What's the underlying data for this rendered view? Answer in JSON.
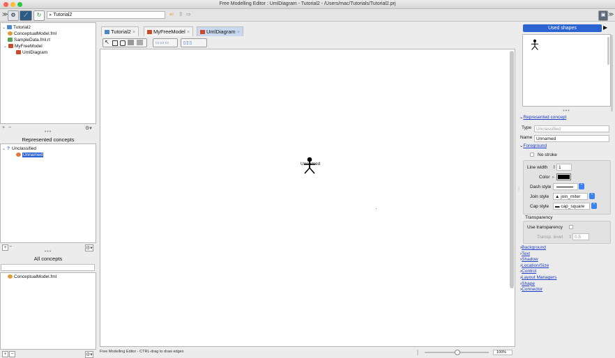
{
  "window": {
    "title": "Free Modelling Editor : UmlDiagram - Tutorial2 - /Users/mac/Tutorials/Tutorial2.prj"
  },
  "toolbar": {
    "path": "Tutorial2"
  },
  "project_tree": {
    "root": "Tutorial2",
    "items": [
      {
        "label": "ConceptualModel.fml"
      },
      {
        "label": "SampleData.fml.rt"
      },
      {
        "label": "MyFreeModel"
      },
      {
        "label": "UmlDiagram"
      }
    ]
  },
  "represented_concepts": {
    "title": "Represented concepts",
    "group": "Unclassified",
    "item": "Unnamed"
  },
  "all_concepts": {
    "title": "All concepts",
    "search_value": "",
    "items": [
      "ConceptualModel.fml"
    ]
  },
  "tabs": [
    {
      "label": "Tutorial2",
      "close": "×"
    },
    {
      "label": "MyFreeModel",
      "close": "×"
    },
    {
      "label": "UmlDiagram",
      "close": "×"
    }
  ],
  "canvas": {
    "shape_label": "Unnamed",
    "status": "Free Modelling Editor - CTRL-drag to draw edges",
    "zoom": "100%",
    "zoom_level": 0.5
  },
  "inspector": {
    "used_shapes_label": "Used shapes",
    "represented_concept": "Represented concept",
    "type_label": "Type",
    "type_value": "Unclassified",
    "name_label": "Name",
    "name_value": "Unnamed",
    "foreground": "Foreground",
    "no_stroke": "No stroke",
    "line_width_label": "Line width",
    "line_width_value": "1",
    "color_label": "Color",
    "color_value": "#000000",
    "dash_style_label": "Dash style",
    "join_style_label": "Join style",
    "join_style_value": "join_miter",
    "cap_style_label": "Cap style",
    "cap_style_value": "cap_square",
    "transparency_label": "Transparency",
    "use_transparency_label": "Use transparency",
    "transp_level_label": "Transp. level",
    "transp_level_value": "0.5",
    "sections": [
      "Background",
      "Text",
      "Shadow",
      "Location/Size",
      "Control",
      "Layout Managers",
      "Shape",
      "Connector"
    ]
  },
  "colors": {
    "accent": "#2b63d3",
    "tab_active": "#c9d9ef"
  }
}
